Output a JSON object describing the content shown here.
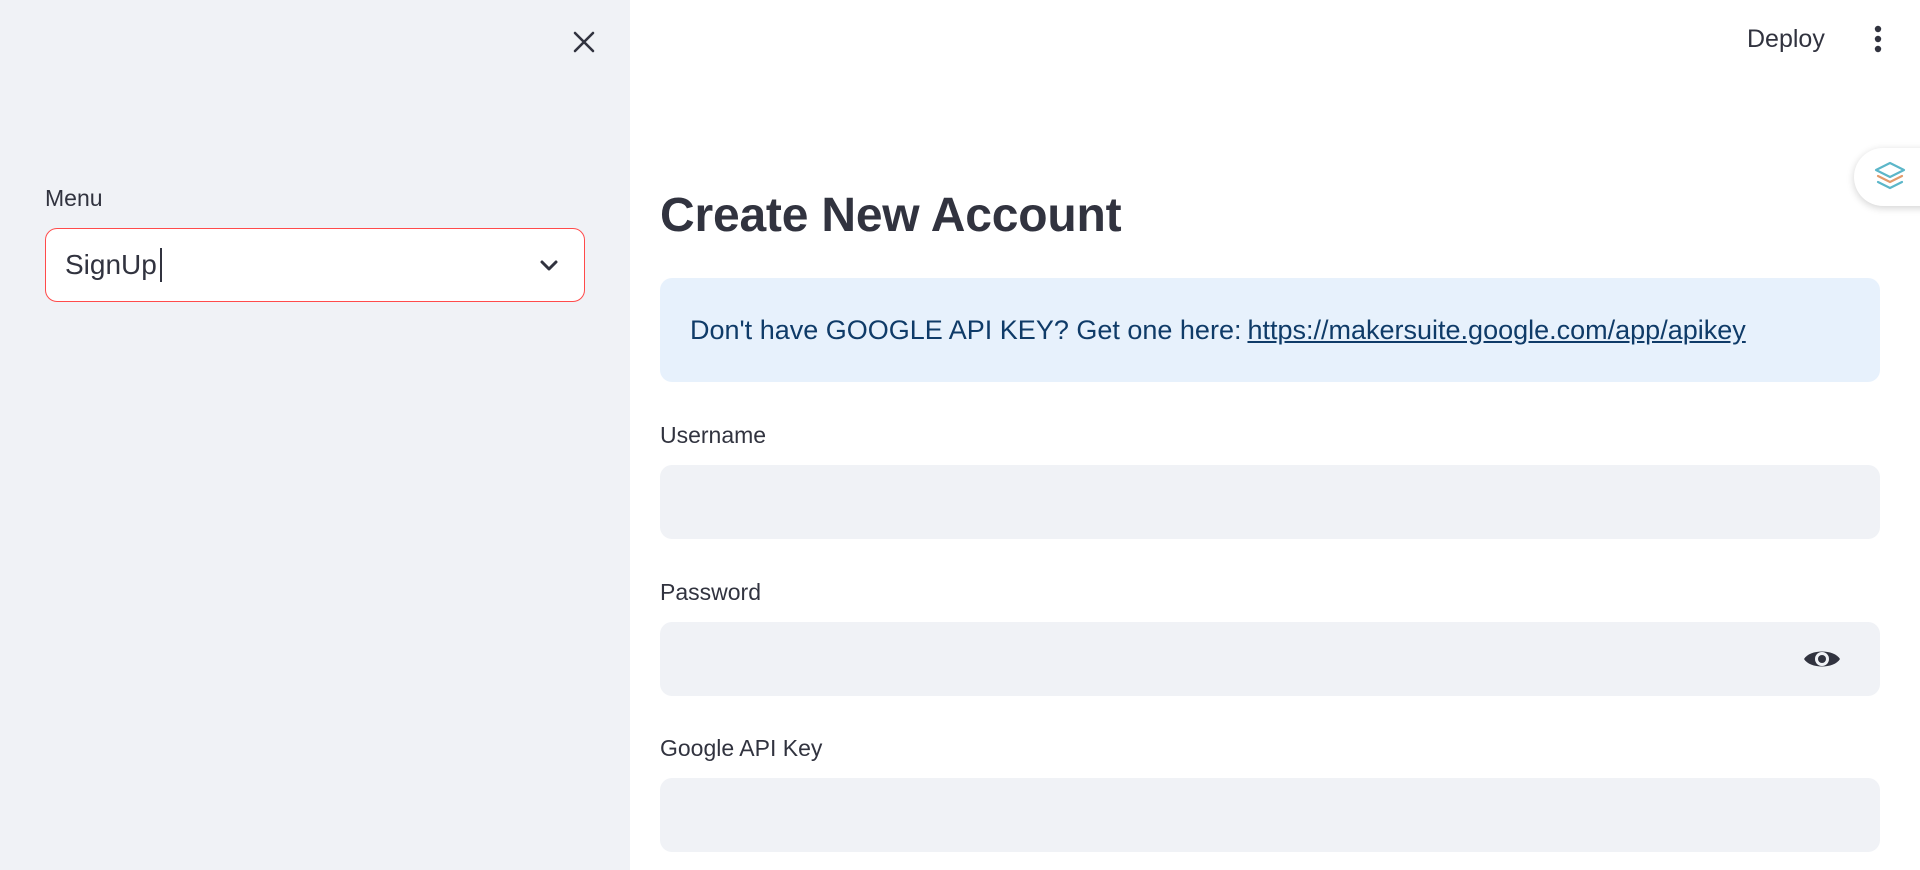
{
  "sidebar": {
    "menu_label": "Menu",
    "select": {
      "value": "SignUp"
    }
  },
  "header": {
    "deploy_label": "Deploy"
  },
  "main": {
    "title": "Create New Account",
    "info": {
      "text": "Don't have GOOGLE API KEY? Get one here:",
      "link_text": "https://makersuite.google.com/app/apikey"
    },
    "fields": {
      "username": {
        "label": "Username",
        "value": ""
      },
      "password": {
        "label": "Password",
        "value": ""
      },
      "api_key": {
        "label": "Google API Key",
        "value": ""
      }
    }
  },
  "icons": {
    "close": "close-icon",
    "chevron": "chevron-down-icon",
    "kebab": "more-vertical-icon",
    "eye": "eye-icon",
    "stack": "layers-icon"
  },
  "colors": {
    "sidebar_bg": "#f0f2f6",
    "focus_border": "#ff4b4b",
    "info_bg": "#e7f1fc",
    "info_text": "#0f3b68",
    "text": "#31333f"
  }
}
